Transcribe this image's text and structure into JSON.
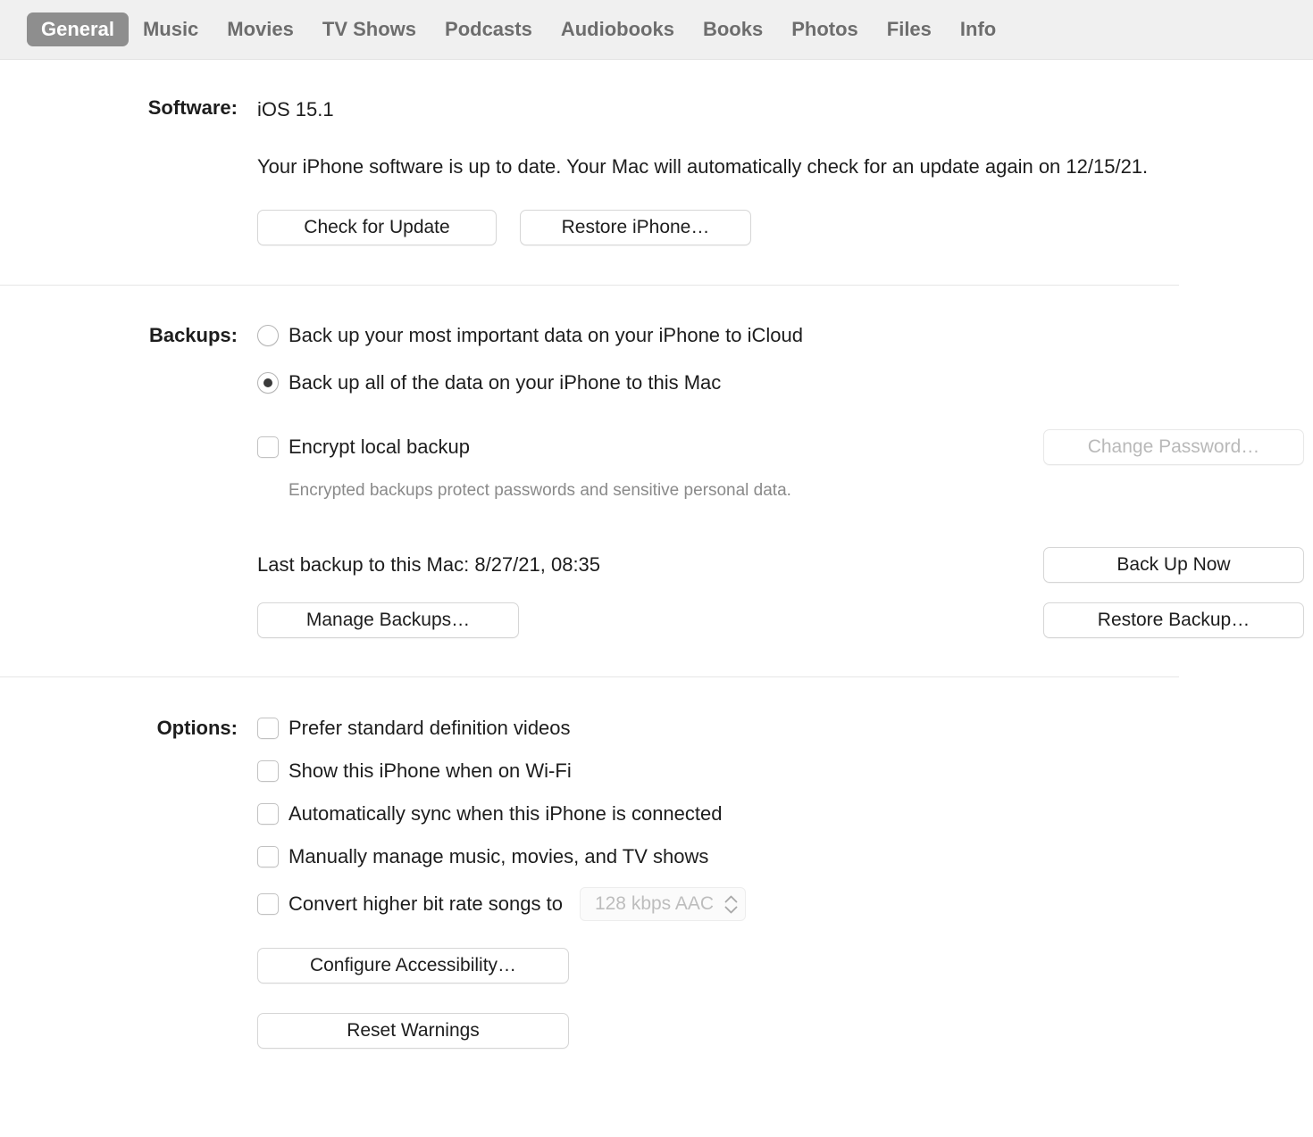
{
  "tabs": [
    {
      "label": "General",
      "selected": true
    },
    {
      "label": "Music",
      "selected": false
    },
    {
      "label": "Movies",
      "selected": false
    },
    {
      "label": "TV Shows",
      "selected": false
    },
    {
      "label": "Podcasts",
      "selected": false
    },
    {
      "label": "Audiobooks",
      "selected": false
    },
    {
      "label": "Books",
      "selected": false
    },
    {
      "label": "Photos",
      "selected": false
    },
    {
      "label": "Files",
      "selected": false
    },
    {
      "label": "Info",
      "selected": false
    }
  ],
  "software": {
    "label": "Software:",
    "version": "iOS 15.1",
    "status_text": "Your iPhone software is up to date. Your Mac will automatically check for an update again on 12/15/21.",
    "check_for_update_button": "Check for Update",
    "restore_iphone_button": "Restore iPhone…"
  },
  "backups": {
    "label": "Backups:",
    "radio_icloud": "Back up your most important data on your iPhone to iCloud",
    "radio_mac": "Back up all of the data on your iPhone to this Mac",
    "selected_option": "mac",
    "encrypt_checkbox_label": "Encrypt local backup",
    "encrypt_checked": false,
    "change_password_button": "Change Password…",
    "change_password_disabled": true,
    "last_backup_text": "Last backup to this Mac: 8/27/21, 08:35",
    "back_up_now_button": "Back Up Now",
    "manage_backups_button": "Manage Backups…",
    "restore_backup_button": "Restore Backup…",
    "encrypt_hint": "Encrypted backups protect passwords and sensitive personal data."
  },
  "options": {
    "label": "Options:",
    "checkboxes": [
      {
        "label": "Prefer standard definition videos",
        "checked": false
      },
      {
        "label": "Show this iPhone when on Wi-Fi",
        "checked": false
      },
      {
        "label": "Automatically sync when this iPhone is connected",
        "checked": false
      },
      {
        "label": "Manually manage music, movies, and TV shows",
        "checked": false
      },
      {
        "label": "Convert higher bit rate songs to",
        "checked": false
      }
    ],
    "bitrate_value": "128 kbps AAC",
    "bitrate_disabled": true,
    "configure_accessibility_button": "Configure Accessibility…",
    "reset_warnings_button": "Reset Warnings"
  },
  "colors": {
    "tabbar_bg": "#f0f0f0",
    "selected_tab_bg": "#8e8e8e",
    "tab_text": "#6d6d6d",
    "body_text": "#1d1d1d",
    "muted_text": "#8a8a8a",
    "disabled_text": "#bdbdbd",
    "divider": "#e6e6e6",
    "button_border": "#d6d6d6"
  }
}
